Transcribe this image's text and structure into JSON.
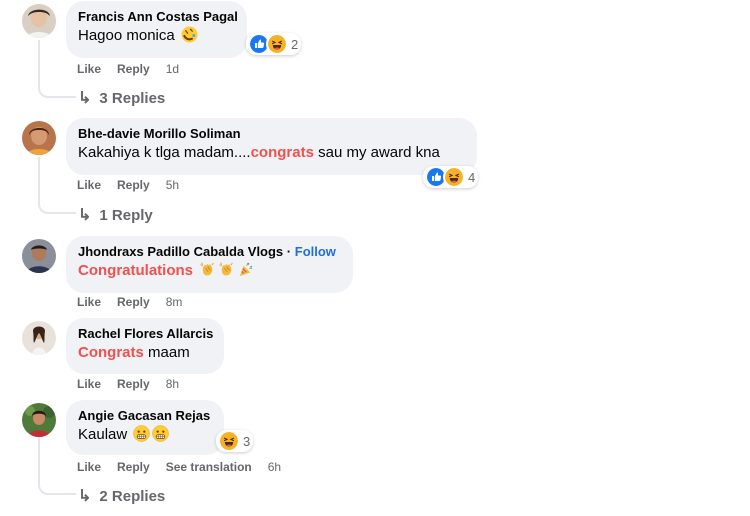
{
  "comments": [
    {
      "author": "Francis Ann Costas Pagal",
      "text": "Hagoo monica",
      "text_emoji": "rolling-laughing-emoji",
      "reactions": {
        "icons": [
          "like-icon",
          "haha-icon"
        ],
        "count": "2"
      },
      "actions": {
        "like": "Like",
        "reply": "Reply",
        "time": "1d"
      },
      "replies": "3 Replies"
    },
    {
      "author": "Bhe-davie Morillo Soliman",
      "text_before": "Kakahiya k tlga madam....",
      "text_highlight": "congrats",
      "text_after": " sau my award kna",
      "reactions": {
        "icons": [
          "like-icon",
          "haha-icon"
        ],
        "count": "4"
      },
      "actions": {
        "like": "Like",
        "reply": "Reply",
        "time": "5h"
      },
      "replies": "1 Reply"
    },
    {
      "author": "Jhondraxs Padillo Cabalda Vlogs",
      "separator": "·",
      "follow": "Follow",
      "text_highlight": "Congratulations",
      "text_emojis": [
        "clapping-hands-emoji",
        "clapping-hands-emoji",
        "party-popper-emoji"
      ],
      "actions": {
        "like": "Like",
        "reply": "Reply",
        "time": "8m"
      }
    },
    {
      "author": "Rachel Flores Allarcis",
      "text_highlight": "Congrats",
      "text_after": " maam",
      "actions": {
        "like": "Like",
        "reply": "Reply",
        "time": "8h"
      }
    },
    {
      "author": "Angie Gacasan Rejas",
      "text": "Kaulaw",
      "text_emojis": [
        "grimacing-emoji",
        "grimacing-emoji"
      ],
      "reactions": {
        "icons": [
          "haha-icon"
        ],
        "count": "3"
      },
      "actions": {
        "like": "Like",
        "reply": "Reply",
        "translate": "See translation",
        "time": "6h"
      },
      "replies": "2 Replies"
    }
  ],
  "colors": {
    "bubble": "#f0f2f5",
    "highlight": "#f0504f",
    "follow": "#216fdb",
    "meta": "#65676b",
    "like": "#1877f2",
    "haha": "#f7b125"
  }
}
